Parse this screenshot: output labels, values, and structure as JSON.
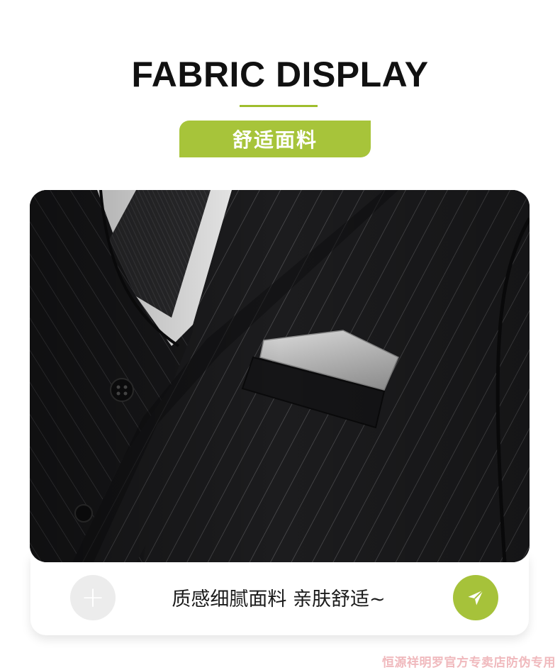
{
  "header": {
    "title": "FABRIC DISPLAY",
    "badge": "舒适面料"
  },
  "caption": {
    "text": "质感细腻面料 亲肤舒适~",
    "plus_symbol": "+"
  },
  "watermark": "恒源祥明罗官方专卖店防伪专用",
  "colors": {
    "accent": "#a7c43a",
    "heading": "#111111",
    "fabric": "#1a1a1c",
    "watermark": "#f0b9bd"
  }
}
